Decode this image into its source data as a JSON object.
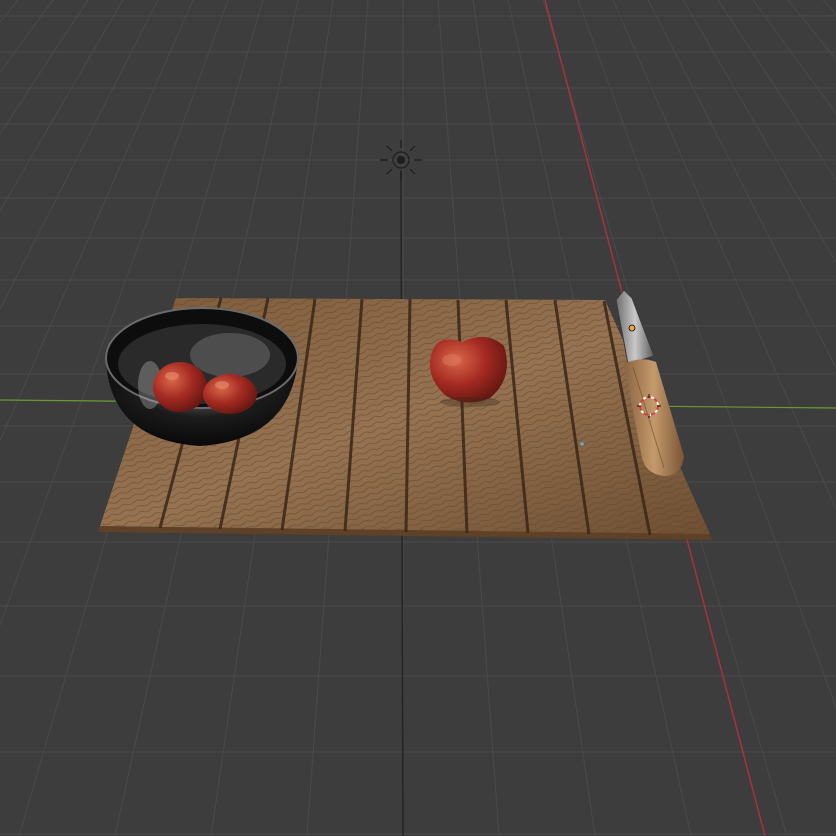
{
  "viewport": {
    "background": "#3d3d3d",
    "grid_color": "#4a4a4a",
    "axis_x_color": "#b3353f",
    "axis_y_color": "#6a9a2e",
    "axis_z_color": "#262626"
  },
  "objects": [
    {
      "name": "wooden-slat-mat",
      "material": "wood",
      "color": "#8a6846"
    },
    {
      "name": "metal-bowl",
      "material": "chrome",
      "color": "#1a1a1a"
    },
    {
      "name": "apple-in-bowl-1",
      "color": "#b3362a"
    },
    {
      "name": "apple-in-bowl-2",
      "color": "#b3362a"
    },
    {
      "name": "apple",
      "color": "#a32a22"
    },
    {
      "name": "knife",
      "handle_color": "#a9825a",
      "blade_color": "#8c8c8c"
    }
  ],
  "gizmos": [
    {
      "name": "light-gizmo-icon"
    },
    {
      "name": "3d-cursor-icon",
      "color": "#e23b3b"
    },
    {
      "name": "selected-origin-icon",
      "color": "#f2a33a"
    }
  ]
}
